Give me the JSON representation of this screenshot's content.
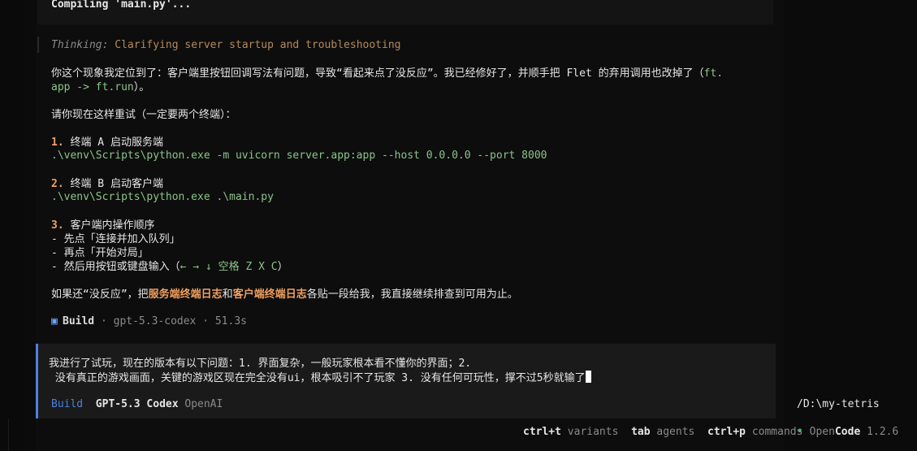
{
  "top": {
    "compiling": "Compiling 'main.py'..."
  },
  "thinking": {
    "label": "Thinking:",
    "title": "Clarifying server startup and troubleshooting"
  },
  "reply": {
    "line1_a": "你这个现象我定位到了：客户端里按钮回调写法有问题，导致“看起来点了没反应”。我已经修好了，并顺手把 Flet 的弃用调用也改掉了（",
    "line1_code": "ft.",
    "line2_code": "app -> ft.run",
    "line2_b": "）。",
    "ask": "请你现在这样重试（一定要两个终端）：",
    "step1_num": "1.",
    "step1_label": "终端 A 启动服务端",
    "step1_cmd": ".\\venv\\Scripts\\python.exe -m uvicorn server.app:app --host 0.0.0.0 --port 8000",
    "step2_num": "2.",
    "step2_label": "终端 B 启动客户端",
    "step2_cmd": ".\\venv\\Scripts\\python.exe .\\main.py",
    "step3_num": "3.",
    "step3_label": "客户端内操作顺序",
    "step3_items": [
      "- 先点「连接并加入队列」",
      "- 再点「开始对局」",
      "- 然后用按钮或键盘输入（"
    ],
    "step3_keys": "← → ↓ 空格 Z X C",
    "step3_close": "）",
    "final_a": "如果还“没反应”，把",
    "final_hl1": "服务端终端日志",
    "final_and": "和",
    "final_hl2": "客户端终端日志",
    "final_b": "各贴一段给我，我直接继续排查到可用为止。"
  },
  "build_meta": {
    "icon": "▣",
    "mode": "Build",
    "sep": " · ",
    "model": "gpt-5.3-codex",
    "time": "51.3s"
  },
  "input": {
    "line1": "我进行了试玩，现在的版本有以下问题：1. 界面复杂，一般玩家根本看不懂你的界面；2.",
    "line2": " 没有真正的游戏画面，关键的游戏区现在完全没有ui，根本吸引不了玩家 3. 没有任何可玩性，撑不过5秒就输了",
    "mode": "Build",
    "model": "GPT-5.3 Codex",
    "provider": "OpenAI"
  },
  "status": {
    "path": "/D:\\my-tetris",
    "shortcuts": [
      {
        "key": "ctrl+t",
        "desc": "variants"
      },
      {
        "key": "tab",
        "desc": "agents"
      },
      {
        "key": "ctrl+p",
        "desc": "commands"
      }
    ],
    "dot": "•",
    "open": "Open",
    "code": "Code",
    "version": "1.2.6"
  },
  "colors": {
    "accent": "#4a82e0",
    "highlight": "#f0a060",
    "code": "#8bc48a",
    "thinking": "#b68a5a",
    "ok": "#3fbf6a"
  }
}
